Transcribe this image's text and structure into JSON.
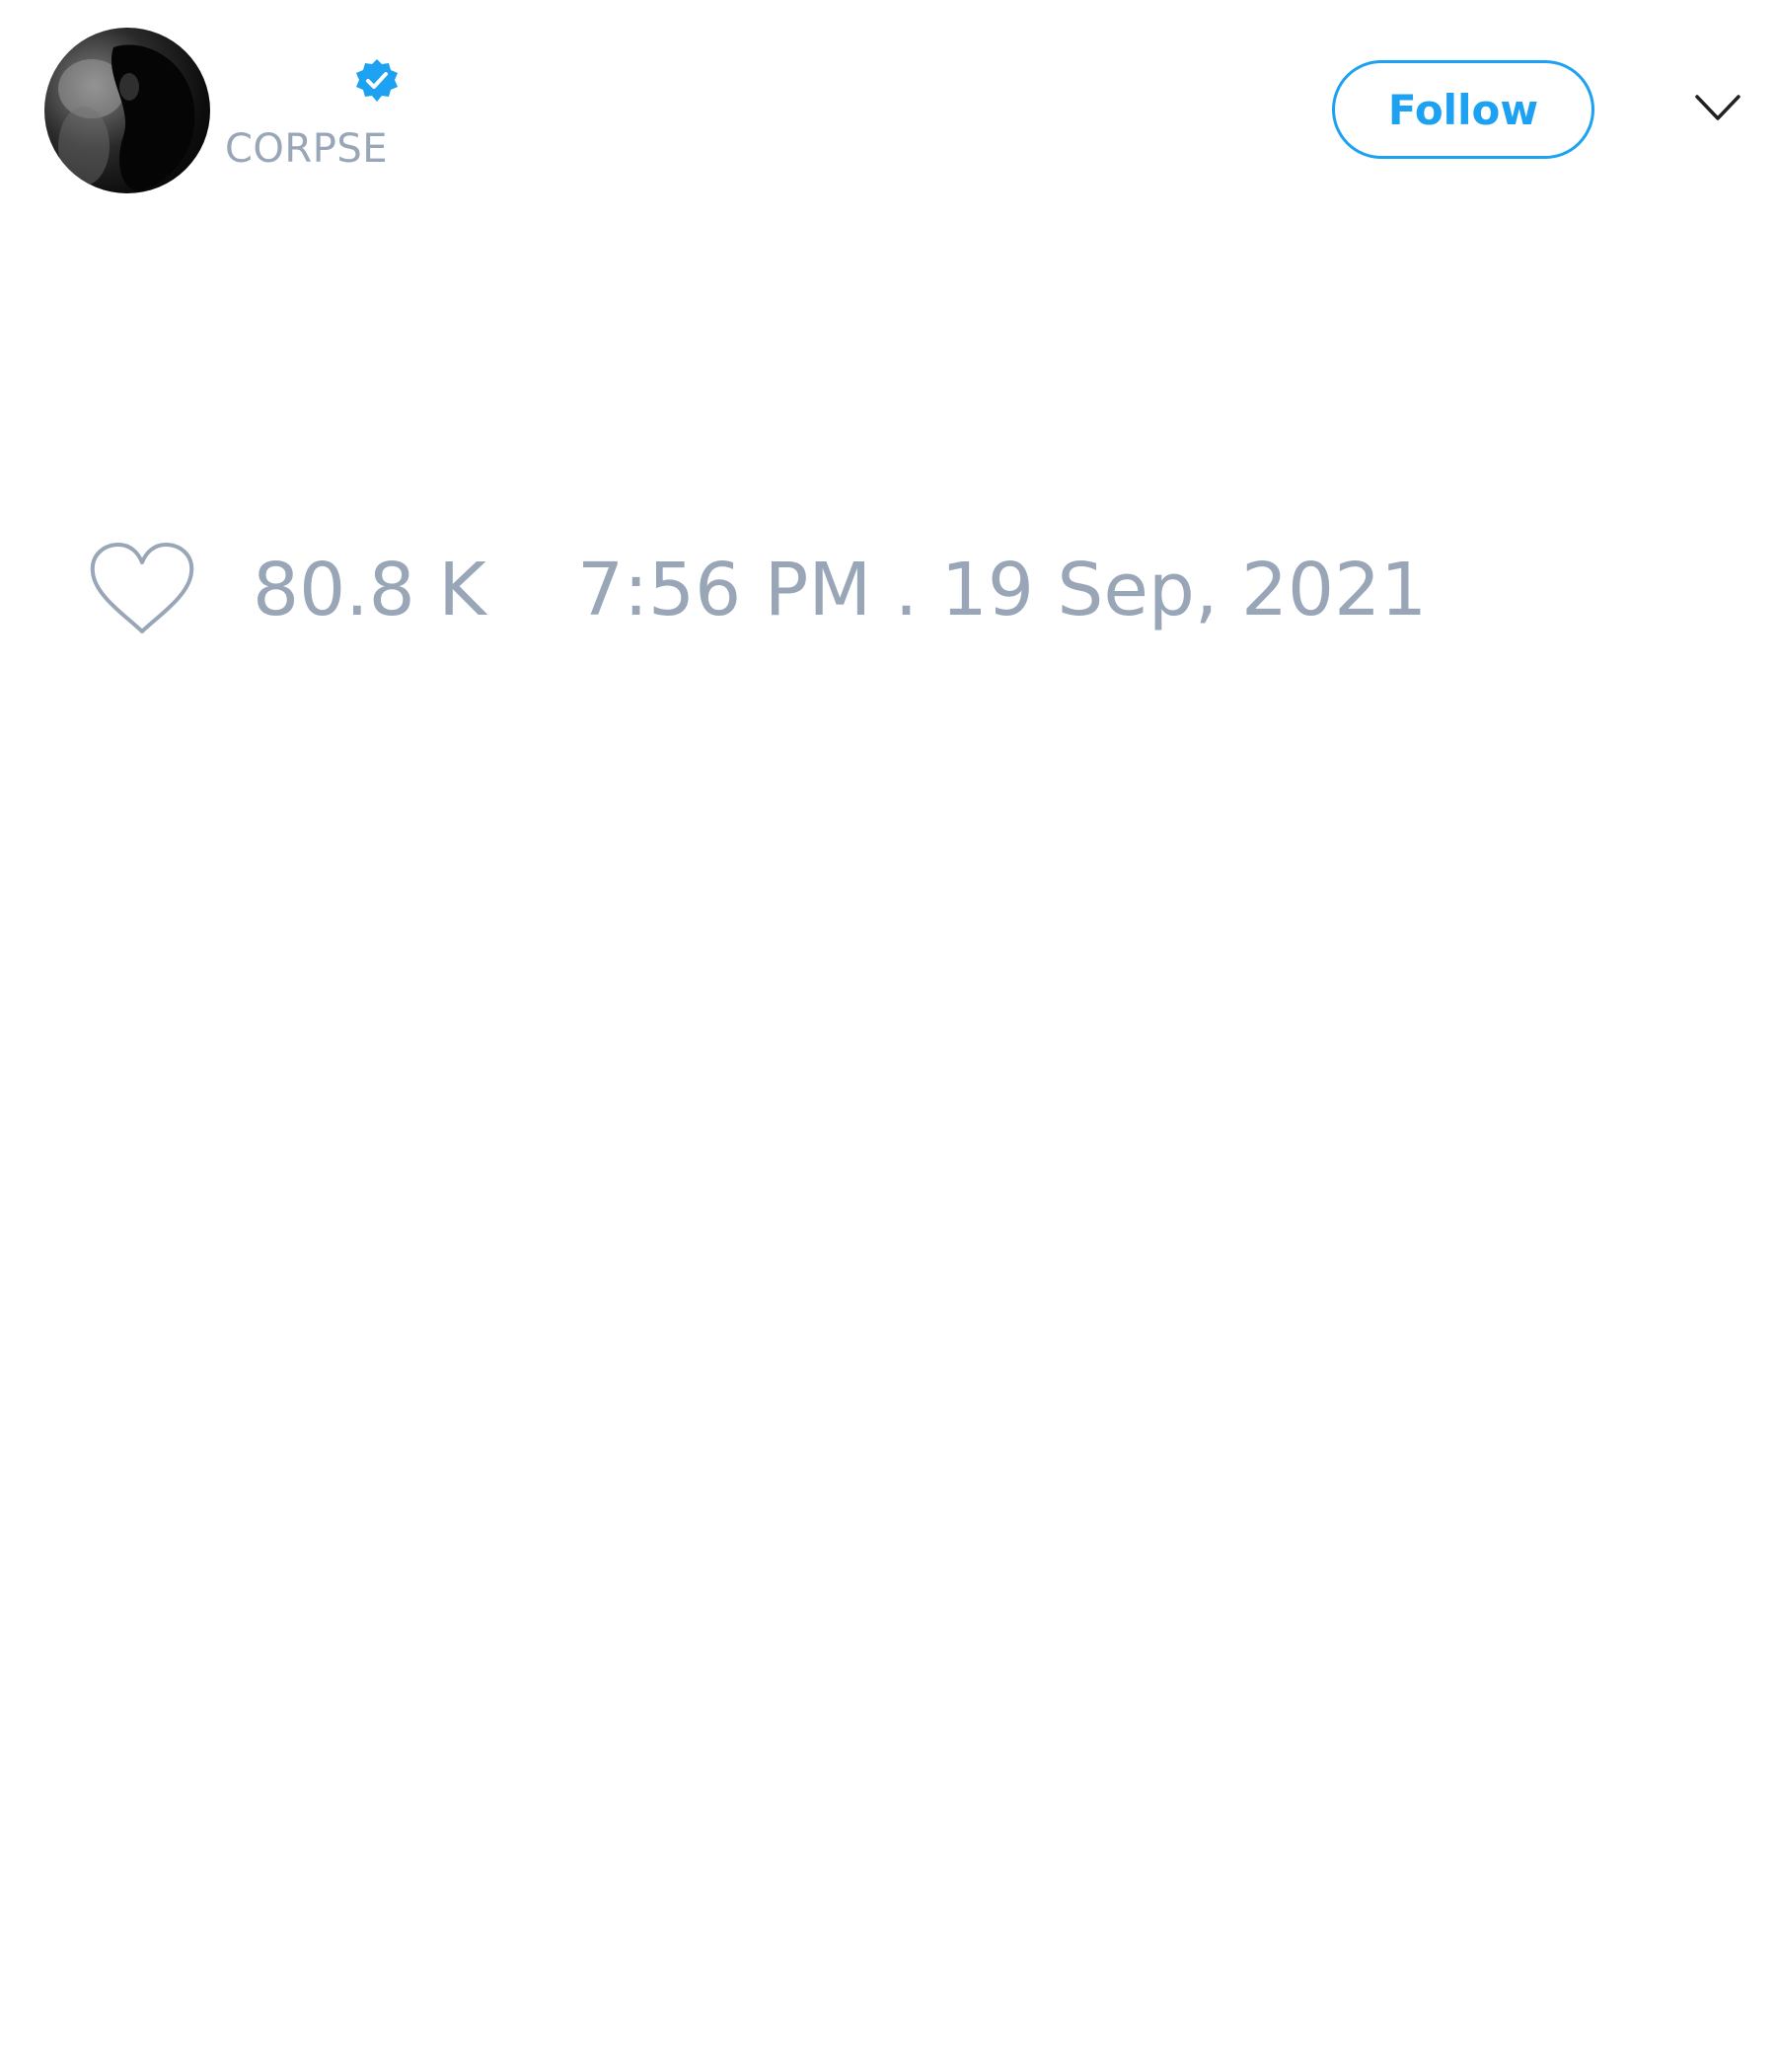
{
  "author": {
    "handle": "CORPSE",
    "verified": true,
    "avatar_icon": "profile-photo"
  },
  "header": {
    "follow_label": "Follow",
    "menu_icon": "chevron-down-icon"
  },
  "stats": {
    "likes": "80.8 K",
    "like_icon": "heart-outline-icon",
    "timestamp": "7:56 PM . 19 Sep, 2021"
  },
  "colors": {
    "accent": "#1da1f2",
    "muted_text": "#98a6b8",
    "background": "#ffffff"
  }
}
